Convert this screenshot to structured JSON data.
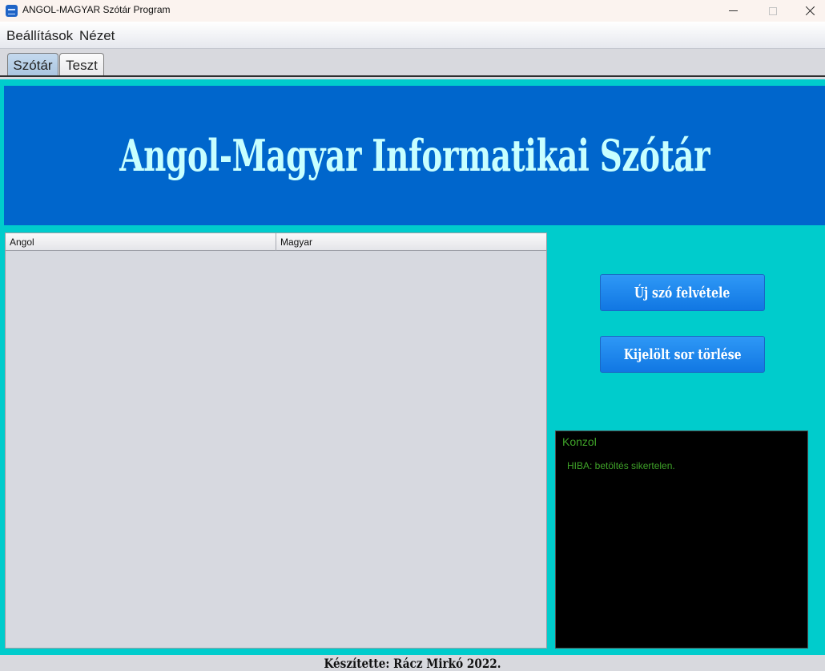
{
  "window": {
    "title": "ANGOL-MAGYAR Szótár Program"
  },
  "menu": {
    "items": [
      "Beállítások",
      "Nézet"
    ]
  },
  "tabs": [
    {
      "label": "Szótár",
      "selected": true
    },
    {
      "label": "Teszt",
      "selected": false
    }
  ],
  "banner": {
    "title": "Angol-Magyar Informatikai Szótár"
  },
  "table": {
    "columns": [
      "Angol",
      "Magyar"
    ],
    "rows": []
  },
  "actions": {
    "add_label": "Új szó felvétele",
    "delete_label": "Kijelölt sor törlése"
  },
  "console": {
    "title": "Konzol",
    "lines": [
      "HIBA: betöltés sikertelen."
    ]
  },
  "footer": {
    "credit": "Készítette: Rácz Mirkó 2022."
  },
  "colors": {
    "background": "#00cccc",
    "banner": "#0066cc",
    "banner_text": "#c8ffff",
    "button": "#1a82ee",
    "console_bg": "#000000",
    "console_text": "#3fa329"
  },
  "icons": {
    "app": "dictionary-app-icon",
    "minimize": "minimize-icon",
    "maximize": "maximize-icon",
    "close": "close-icon"
  }
}
